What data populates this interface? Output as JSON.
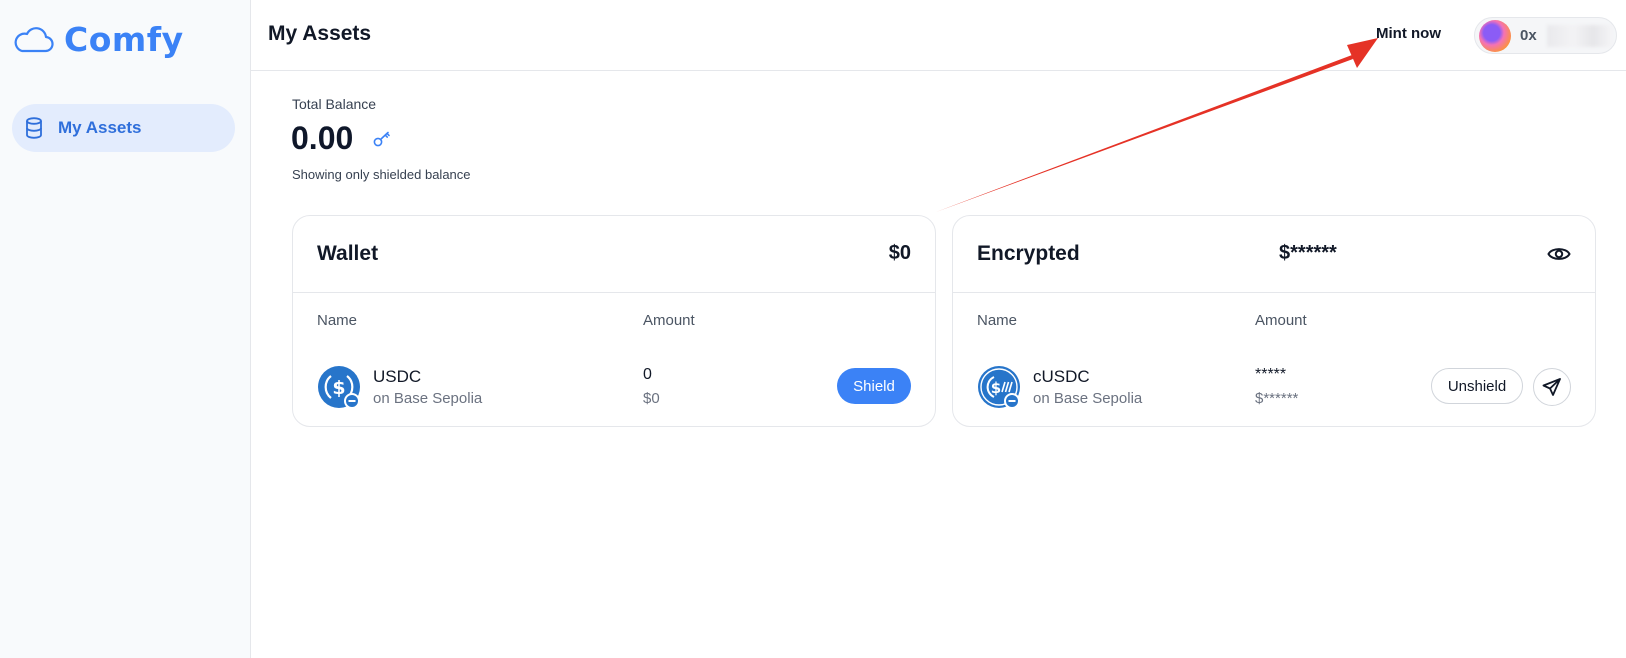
{
  "app": {
    "name": "Comfy"
  },
  "sidebar": {
    "items": [
      {
        "label": "My Assets",
        "icon": "database-icon"
      }
    ]
  },
  "header": {
    "title": "My Assets",
    "mint_label": "Mint now",
    "wallet_address": "0x"
  },
  "balance": {
    "label": "Total Balance",
    "value": "0.00",
    "note": "Showing only shielded balance"
  },
  "wallet_card": {
    "title": "Wallet",
    "total": "$0",
    "columns": {
      "name": "Name",
      "amount": "Amount"
    },
    "token": {
      "symbol": "USDC",
      "network": "on Base Sepolia",
      "amount": "0",
      "amount_usd": "$0"
    },
    "action_label": "Shield"
  },
  "encrypted_card": {
    "title": "Encrypted",
    "total": "$******",
    "columns": {
      "name": "Name",
      "amount": "Amount"
    },
    "token": {
      "symbol": "cUSDC",
      "network": "on Base Sepolia",
      "amount": "*****",
      "amount_usd": "$******"
    },
    "action_label": "Unshield"
  },
  "colors": {
    "accent": "#3b82f6",
    "nav_active_bg": "#e3ecfd",
    "annotation_arrow": "#e53226"
  }
}
